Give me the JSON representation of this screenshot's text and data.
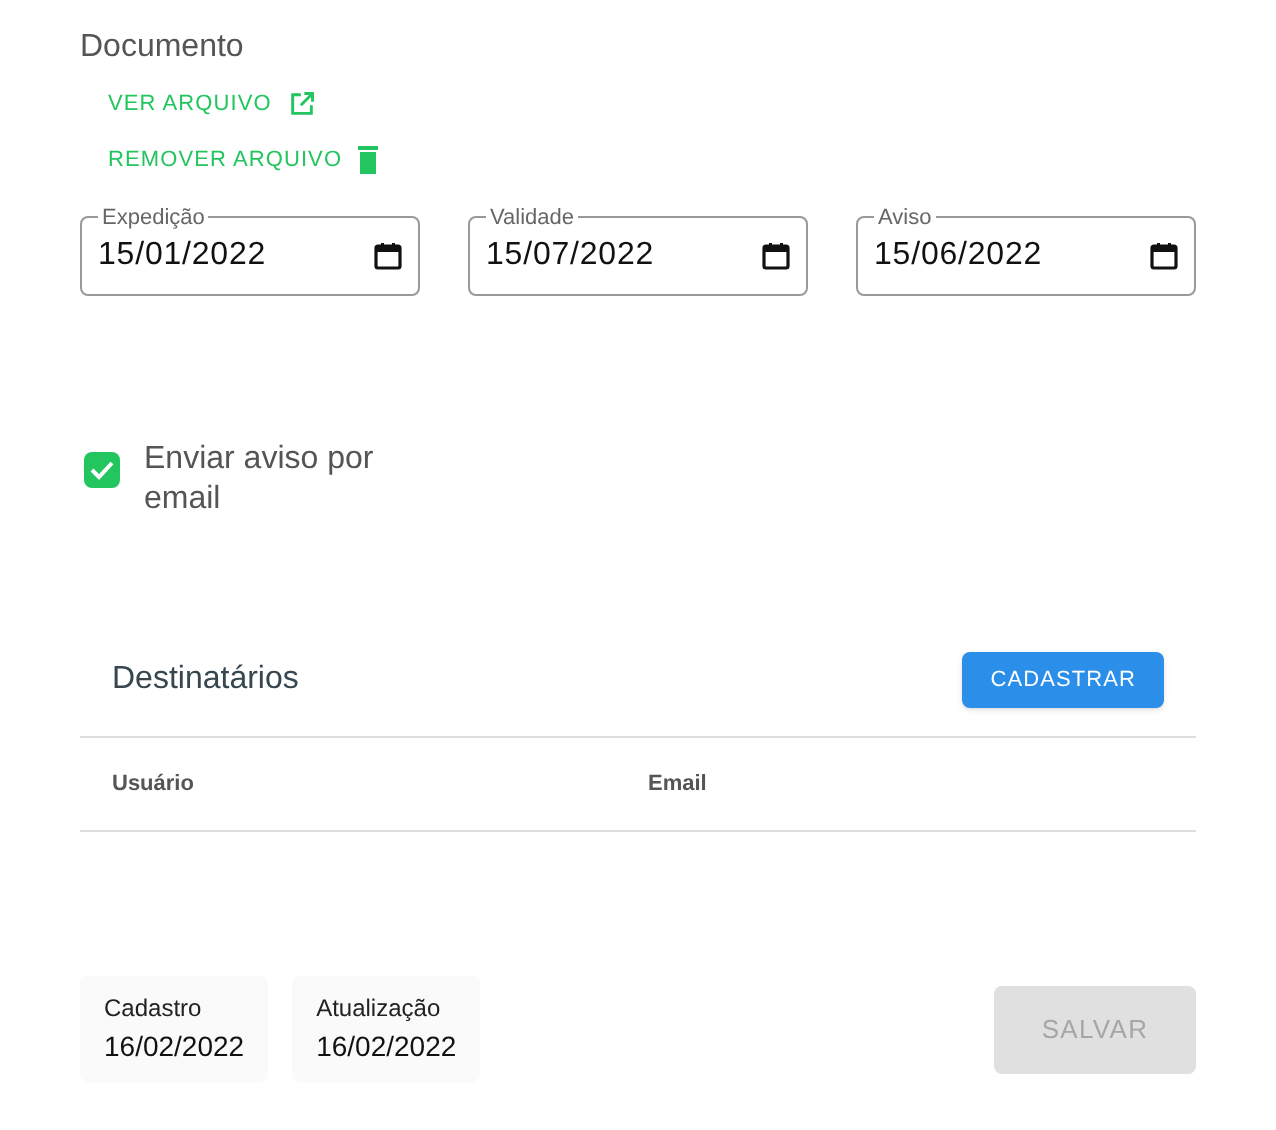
{
  "section_title": "Documento",
  "file_actions": [
    {
      "label": "VER ARQUIVO",
      "kind": "open"
    },
    {
      "label": "REMOVER ARQUIVO",
      "kind": "delete"
    }
  ],
  "date_fields": [
    {
      "label": "Expedição",
      "value": "15/01/2022"
    },
    {
      "label": "Validade",
      "value": "15/07/2022"
    },
    {
      "label": "Aviso",
      "value": "15/06/2022"
    }
  ],
  "email_notice": {
    "label": "Enviar aviso por email",
    "checked": true
  },
  "recipients": {
    "title": "Destinatários",
    "button": "CADASTRAR",
    "columns": [
      "Usuário",
      "Email"
    ]
  },
  "info": [
    {
      "label": "Cadastro",
      "value": "16/02/2022"
    },
    {
      "label": "Atualização",
      "value": "16/02/2022"
    }
  ],
  "save_button": {
    "label": "SALVAR",
    "disabled": true
  }
}
